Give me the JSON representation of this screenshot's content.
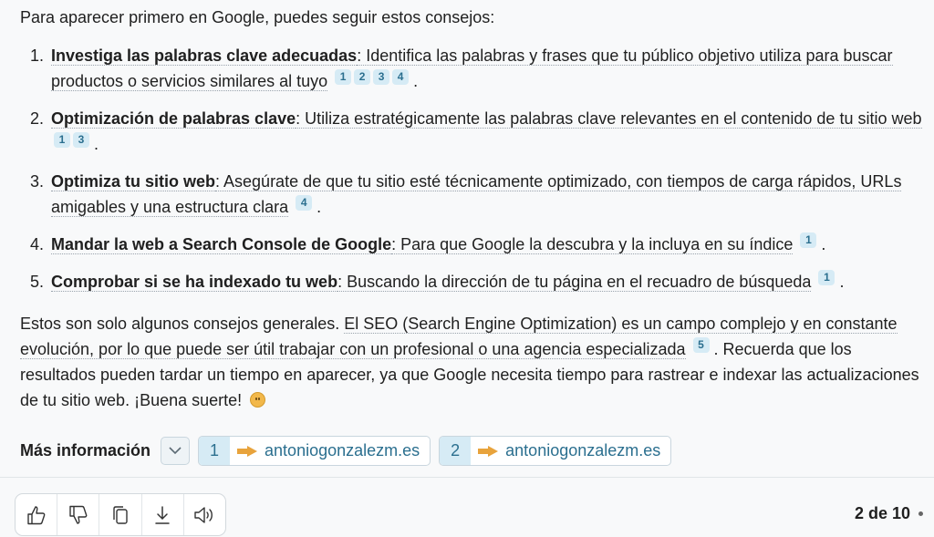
{
  "intro": "Para aparecer primero en Google, puedes seguir estos consejos:",
  "items": [
    {
      "num": "1.",
      "term": "Investiga las palabras clave adecuadas",
      "desc": ": Identifica las palabras y frases que tu público objetivo utiliza para buscar productos o servicios similares al tuyo",
      "cites": [
        "1",
        "2",
        "3",
        "4"
      ]
    },
    {
      "num": "2.",
      "term": "Optimización de palabras clave",
      "desc": ": Utiliza estratégicamente las palabras clave relevantes en el contenido de tu sitio web",
      "cites": [
        "1",
        "3"
      ]
    },
    {
      "num": "3.",
      "term": "Optimiza tu sitio web",
      "desc": ": Asegúrate de que tu sitio esté técnicamente optimizado, con tiempos de carga rápidos, URLs amigables y una estructura clara",
      "cites": [
        "4"
      ]
    },
    {
      "num": "4.",
      "term": "Mandar la web a Search Console de Google",
      "desc": ": Para que Google la descubra y la incluya en su índice",
      "cites": [
        "1"
      ]
    },
    {
      "num": "5.",
      "term": "Comprobar si se ha indexado tu web",
      "desc": ": Buscando la dirección de tu página en el recuadro de búsqueda",
      "cites": [
        "1"
      ]
    }
  ],
  "outro": {
    "plain": "Estos son solo algunos consejos generales. ",
    "dotted": "El SEO (Search Engine Optimization) es un campo complejo y en constante evolución, por lo que puede ser útil trabajar con un profesional o una agencia especializada",
    "cite": "5",
    "rest": ". Recuerda que los resultados pueden tardar un tiempo en aparecer, ya que Google necesita tiempo para rastrear e indexar las actualizaciones de tu sitio web. ¡Buena suerte!",
    "emoji": "smiling-face-icon"
  },
  "more_info": {
    "label": "Más información",
    "sources": [
      {
        "num": "1",
        "domain": "antoniogonzalezm.es"
      },
      {
        "num": "2",
        "domain": "antoniogonzalezm.es"
      }
    ]
  },
  "actions": [
    "thumbs-up-icon",
    "thumbs-down-icon",
    "copy-icon",
    "download-icon",
    "speaker-icon"
  ],
  "pager": "2 de 10",
  "colors": {
    "citation_bg": "#d6ebf5",
    "citation_fg": "#2b6f8f",
    "arrow": "#e8a33c"
  }
}
